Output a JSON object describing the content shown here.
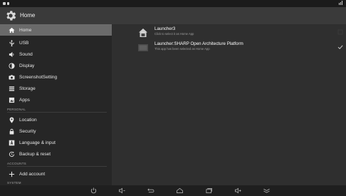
{
  "header": {
    "title": "Home"
  },
  "sidebar": {
    "items": [
      {
        "label": "Home",
        "icon": "home-icon",
        "selected": true
      },
      {
        "label": "USB",
        "icon": "usb-icon"
      },
      {
        "label": "Sound",
        "icon": "speaker-icon"
      },
      {
        "label": "Display",
        "icon": "display-icon"
      },
      {
        "label": "ScreenshotSetting",
        "icon": "camera-icon"
      },
      {
        "label": "Storage",
        "icon": "storage-icon"
      },
      {
        "label": "Apps",
        "icon": "apps-icon"
      },
      {
        "label": "Location",
        "icon": "location-pin-icon"
      },
      {
        "label": "Security",
        "icon": "lock-icon"
      },
      {
        "label": "Language & input",
        "icon": "language-icon"
      },
      {
        "label": "Backup & reset",
        "icon": "backup-icon"
      },
      {
        "label": "Add account",
        "icon": "plus-icon"
      }
    ],
    "sections": {
      "personal": "PERSONAL",
      "accounts": "ACCOUNTS",
      "system": "SYSTEM"
    }
  },
  "home_apps": [
    {
      "name": "Launcher3",
      "description": "Click to select it as Home App",
      "selected": false
    },
    {
      "name": "Launcher:SHARP Open Architecture Platform",
      "description": "This app has been selected as Home App",
      "selected": true
    }
  ],
  "navbar": {
    "buttons": [
      "power-icon",
      "volume-down-icon",
      "back-icon",
      "home-icon",
      "recents-icon",
      "volume-up-icon",
      "collapse-icon"
    ]
  },
  "colors": {
    "selected_bg": "#6a6a6a",
    "sidebar_bg": "#262626",
    "main_bg": "#2f2f2f"
  }
}
